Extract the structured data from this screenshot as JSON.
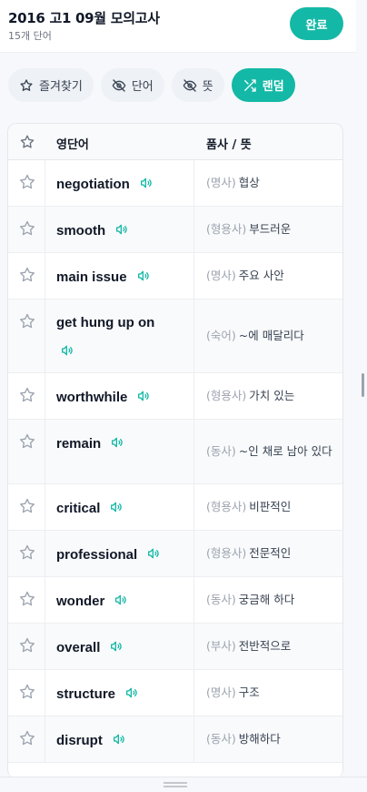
{
  "header": {
    "title": "2016 고1 09월 모의고사",
    "subtitle": "15개 단어",
    "done_label": "완료"
  },
  "filters": [
    {
      "label": "즐겨찾기",
      "icon": "star-icon",
      "active": false
    },
    {
      "label": "단어",
      "icon": "eye-off-icon",
      "active": false
    },
    {
      "label": "뜻",
      "icon": "eye-off-icon",
      "active": false
    },
    {
      "label": "랜덤",
      "icon": "shuffle-icon",
      "active": true
    }
  ],
  "table": {
    "col_word": "영단어",
    "col_meaning": "품사 / 뜻",
    "rows": [
      {
        "word": "negotiation",
        "pos": "(명사)",
        "meaning": "협상"
      },
      {
        "word": "smooth",
        "pos": "(형용사)",
        "meaning": "부드러운"
      },
      {
        "word": "main issue",
        "pos": "(명사)",
        "meaning": "주요 사안"
      },
      {
        "word": "get hung up on",
        "pos": "(숙어)",
        "meaning": "~에 매달리다"
      },
      {
        "word": "worthwhile",
        "pos": "(형용사)",
        "meaning": "가치 있는"
      },
      {
        "word": "remain",
        "pos": "(동사)",
        "meaning": "~인 채로 남아 있다"
      },
      {
        "word": "critical",
        "pos": "(형용사)",
        "meaning": "비판적인"
      },
      {
        "word": "professional",
        "pos": "(형용사)",
        "meaning": "전문적인"
      },
      {
        "word": "wonder",
        "pos": "(동사)",
        "meaning": "궁금해 하다"
      },
      {
        "word": "overall",
        "pos": "(부사)",
        "meaning": "전반적으로"
      },
      {
        "word": "structure",
        "pos": "(명사)",
        "meaning": "구조"
      },
      {
        "word": "disrupt",
        "pos": "(동사)",
        "meaning": "방해하다"
      }
    ]
  },
  "colors": {
    "accent": "#14b8a6",
    "star_outline": "#9ca3af"
  }
}
